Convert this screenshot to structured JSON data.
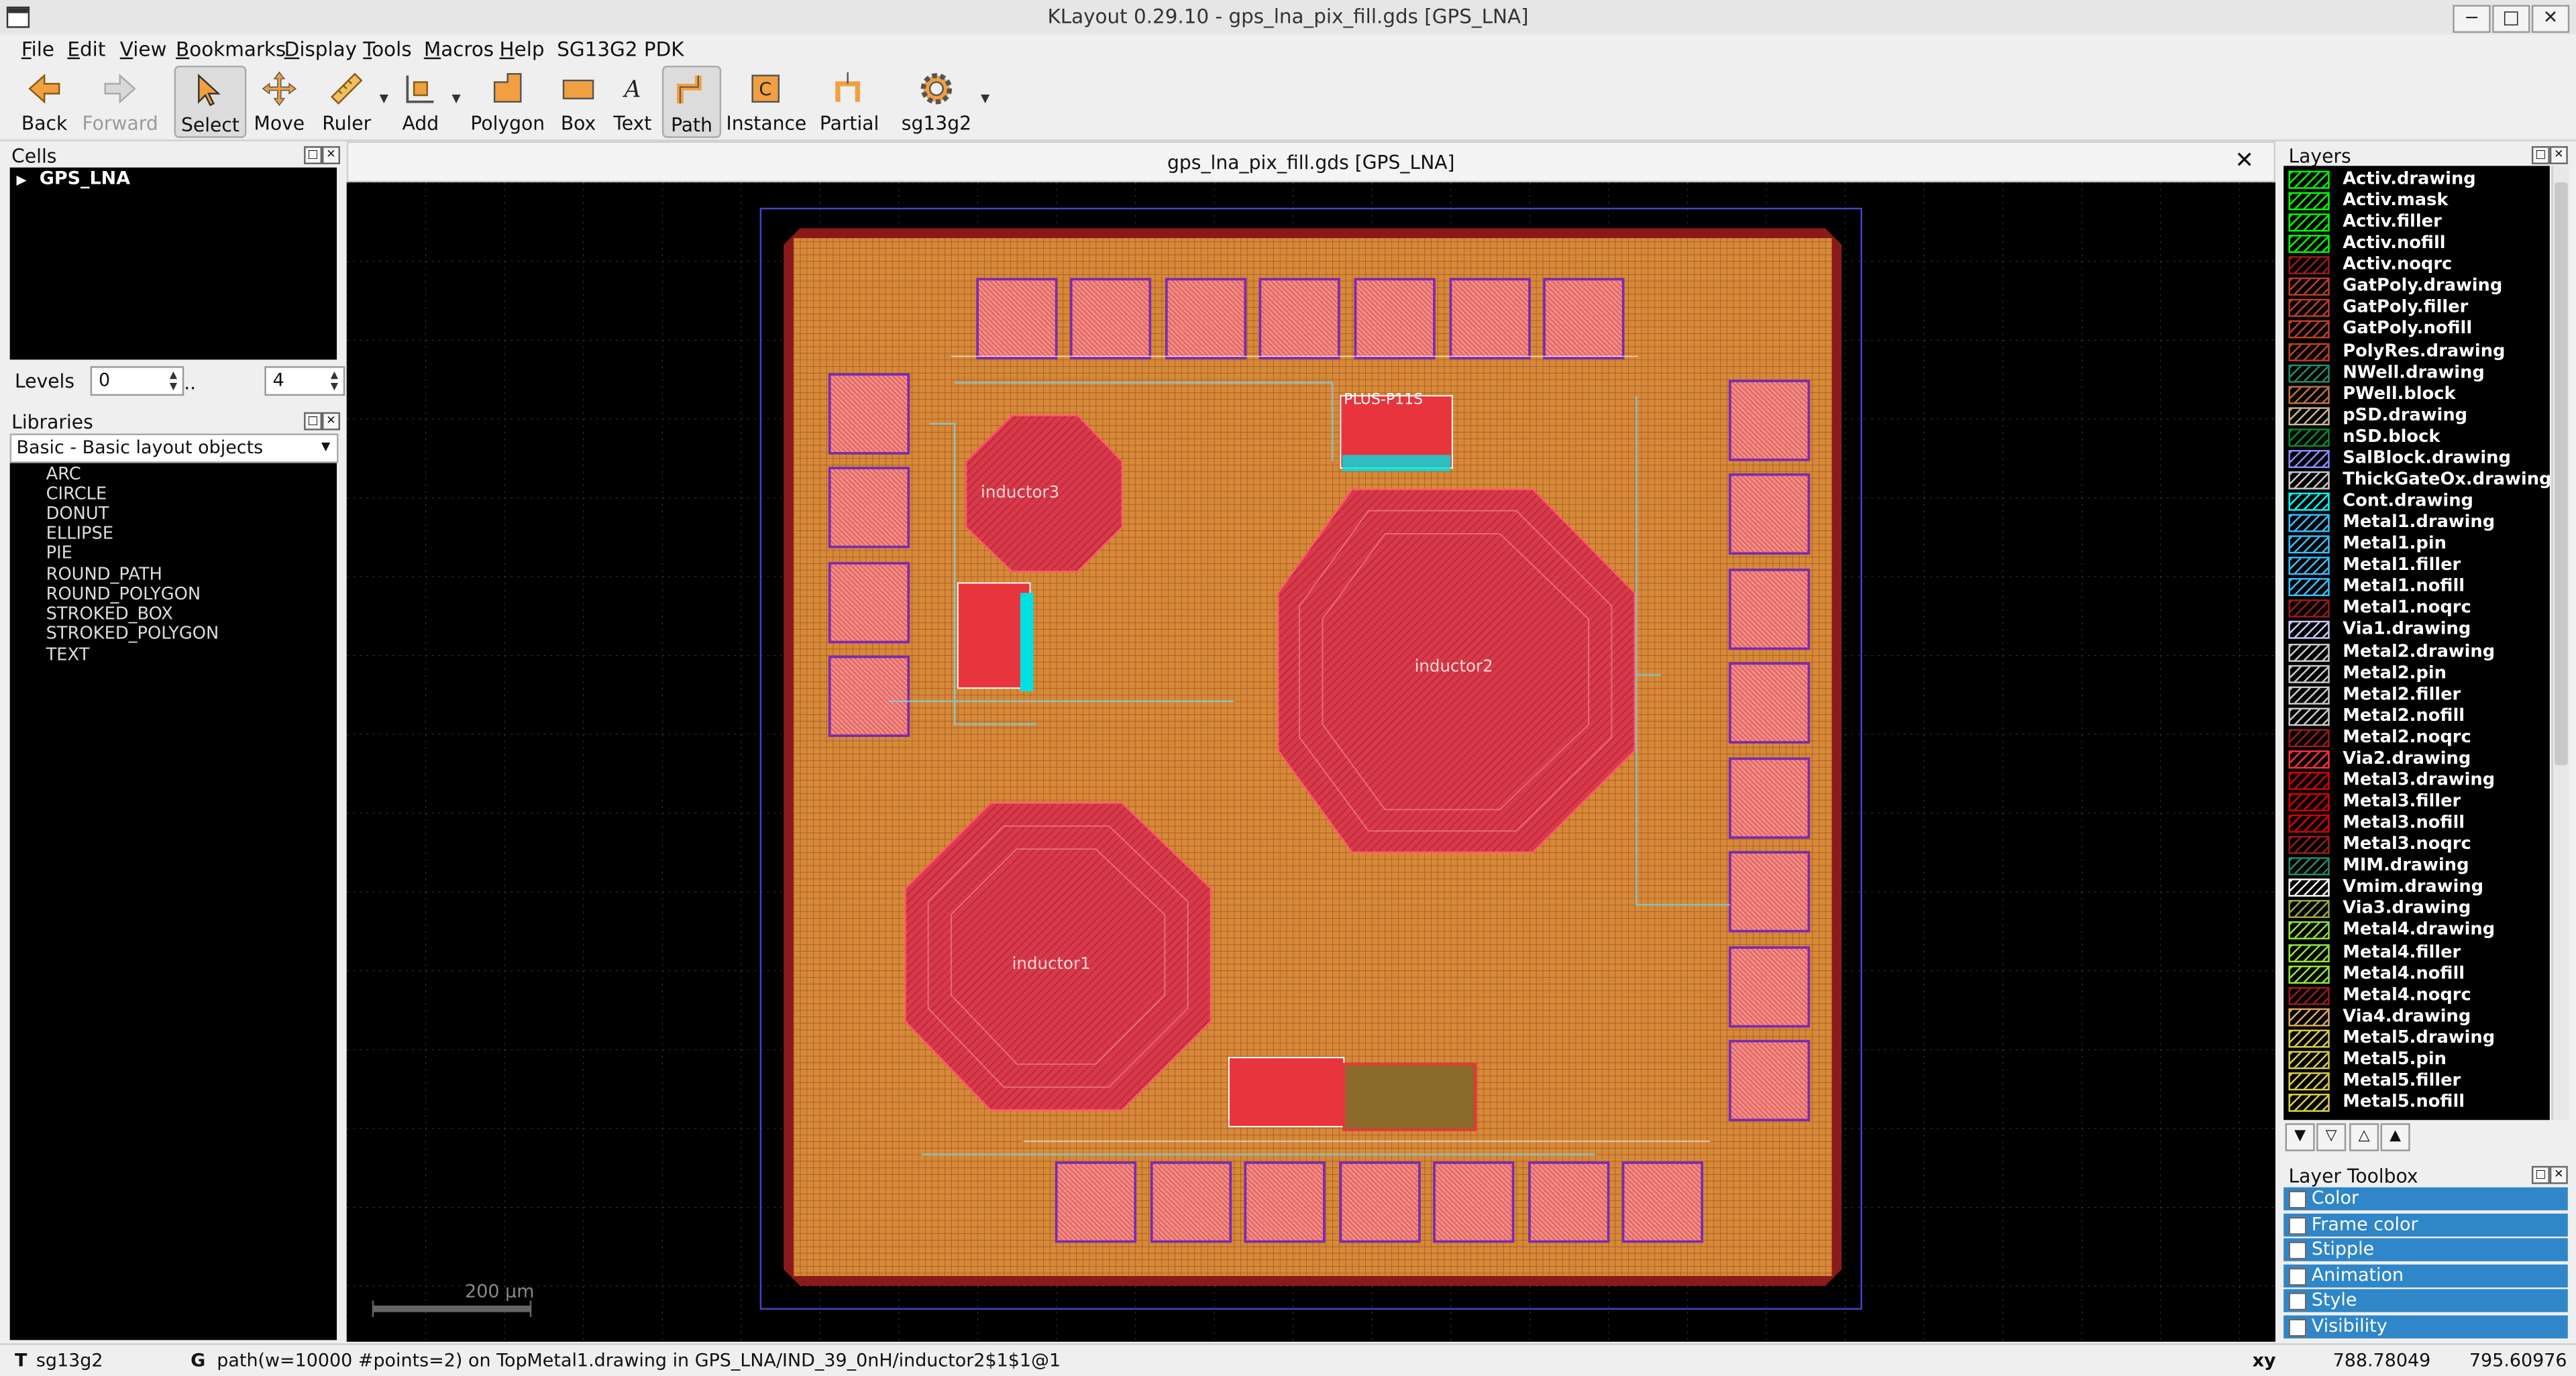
{
  "window": {
    "title": "KLayout 0.29.10 - gps_lna_pix_fill.gds [GPS_LNA]",
    "controls": [
      "minimize-icon",
      "maximize-icon",
      "close-icon"
    ]
  },
  "menu": [
    "File",
    "Edit",
    "View",
    "Bookmarks",
    "Display",
    "Tools",
    "Macros",
    "Help",
    "SG13G2 PDK"
  ],
  "toolbar": [
    {
      "label": "Back",
      "icon": "back-arrow-icon",
      "state": "normal"
    },
    {
      "label": "Forward",
      "icon": "forward-arrow-icon",
      "state": "disabled"
    },
    {
      "label": "Select",
      "icon": "select-cursor-icon",
      "state": "active"
    },
    {
      "label": "Move",
      "icon": "move-arrows-icon",
      "state": "normal"
    },
    {
      "label": "Ruler",
      "icon": "ruler-icon",
      "state": "normal"
    },
    {
      "label": "Add",
      "icon": "add-ruler-icon",
      "state": "normal"
    },
    {
      "label": "Polygon",
      "icon": "polygon-icon",
      "state": "normal"
    },
    {
      "label": "Box",
      "icon": "box-icon",
      "state": "normal"
    },
    {
      "label": "Text",
      "icon": "text-icon",
      "state": "normal"
    },
    {
      "label": "Path",
      "icon": "path-icon",
      "state": "active"
    },
    {
      "label": "Instance",
      "icon": "instance-icon",
      "state": "normal"
    },
    {
      "label": "Partial",
      "icon": "partial-icon",
      "state": "normal"
    },
    {
      "label": "sg13g2",
      "icon": "gear-icon",
      "state": "normal"
    }
  ],
  "cells": {
    "title": "Cells",
    "tree": [
      {
        "name": "GPS_LNA",
        "expanded": false
      }
    ]
  },
  "levels": {
    "label": "Levels",
    "from": "0",
    "sep": "..",
    "to": "4"
  },
  "libraries": {
    "title": "Libraries",
    "selected": "Basic - Basic layout objects",
    "items": [
      "ARC",
      "CIRCLE",
      "DONUT",
      "ELLIPSE",
      "PIE",
      "ROUND_PATH",
      "ROUND_POLYGON",
      "STROKED_BOX",
      "STROKED_POLYGON",
      "TEXT"
    ]
  },
  "view": {
    "tab_title": "gps_lna_pix_fill.gds [GPS_LNA]",
    "scale_label": "200 µm",
    "layout_labels": [
      "inductor3",
      "inductor2",
      "inductor1",
      "PLUS-P11S"
    ]
  },
  "layers": {
    "title": "Layers",
    "items": [
      {
        "name": "Activ.drawing",
        "color": "#00ff00"
      },
      {
        "name": "Activ.mask",
        "color": "#00ff00"
      },
      {
        "name": "Activ.filler",
        "color": "#00ff00"
      },
      {
        "name": "Activ.nofill",
        "color": "#00ff00"
      },
      {
        "name": "Activ.noqrc",
        "color": "#9b1c1c"
      },
      {
        "name": "GatPoly.drawing",
        "color": "#bf4026"
      },
      {
        "name": "GatPoly.filler",
        "color": "#bf4026"
      },
      {
        "name": "GatPoly.nofill",
        "color": "#bf4026"
      },
      {
        "name": "PolyRes.drawing",
        "color": "#bf4026"
      },
      {
        "name": "NWell.drawing",
        "color": "#268c6b"
      },
      {
        "name": "PWell.block",
        "color": "#bf7340"
      },
      {
        "name": "pSD.drawing",
        "color": "#ccb899"
      },
      {
        "name": "nSD.block",
        "color": "#0a8c2e"
      },
      {
        "name": "SalBlock.drawing",
        "color": "#8c8cff"
      },
      {
        "name": "ThickGateOx.drawing",
        "color": "#cccccc"
      },
      {
        "name": "Cont.drawing",
        "color": "#00ffff"
      },
      {
        "name": "Metal1.drawing",
        "color": "#39bfff"
      },
      {
        "name": "Metal1.pin",
        "color": "#39bfff"
      },
      {
        "name": "Metal1.filler",
        "color": "#39bfff"
      },
      {
        "name": "Metal1.nofill",
        "color": "#39bfff"
      },
      {
        "name": "Metal1.noqrc",
        "color": "#9b1c1c"
      },
      {
        "name": "Via1.drawing",
        "color": "#ccccff"
      },
      {
        "name": "Metal2.drawing",
        "color": "#cccccc"
      },
      {
        "name": "Metal2.pin",
        "color": "#cccccc"
      },
      {
        "name": "Metal2.filler",
        "color": "#cccccc"
      },
      {
        "name": "Metal2.nofill",
        "color": "#cccccc"
      },
      {
        "name": "Metal2.noqrc",
        "color": "#9b1c1c"
      },
      {
        "name": "Via2.drawing",
        "color": "#ff3333"
      },
      {
        "name": "Metal3.drawing",
        "color": "#d80000"
      },
      {
        "name": "Metal3.filler",
        "color": "#d80000"
      },
      {
        "name": "Metal3.nofill",
        "color": "#d80000"
      },
      {
        "name": "Metal3.noqrc",
        "color": "#9b1c1c"
      },
      {
        "name": "MIM.drawing",
        "color": "#268c6b"
      },
      {
        "name": "Vmim.drawing",
        "color": "#ffffff"
      },
      {
        "name": "Via3.drawing",
        "color": "#9ba940"
      },
      {
        "name": "Metal4.drawing",
        "color": "#93e837"
      },
      {
        "name": "Metal4.filler",
        "color": "#93e837"
      },
      {
        "name": "Metal4.nofill",
        "color": "#93e837"
      },
      {
        "name": "Metal4.noqrc",
        "color": "#9b1c1c"
      },
      {
        "name": "Via4.drawing",
        "color": "#deac5e"
      },
      {
        "name": "Metal5.drawing",
        "color": "#dcd146"
      },
      {
        "name": "Metal5.pin",
        "color": "#dcd146"
      },
      {
        "name": "Metal5.filler",
        "color": "#dcd146"
      },
      {
        "name": "Metal5.nofill",
        "color": "#dcd146"
      }
    ]
  },
  "layer_toolbox": {
    "title": "Layer Toolbox",
    "sections": [
      "Color",
      "Frame color",
      "Stipple",
      "Animation",
      "Style",
      "Visibility"
    ]
  },
  "status": {
    "mode_key": "T",
    "technology": "sg13g2",
    "grid_key": "G",
    "message": "path(w=10000 #points=2) on TopMetal1.drawing in GPS_LNA/IND_39_0nH/inductor2$1$1@1",
    "coord_label": "xy",
    "x": "788.78049",
    "y": "795.60976"
  }
}
